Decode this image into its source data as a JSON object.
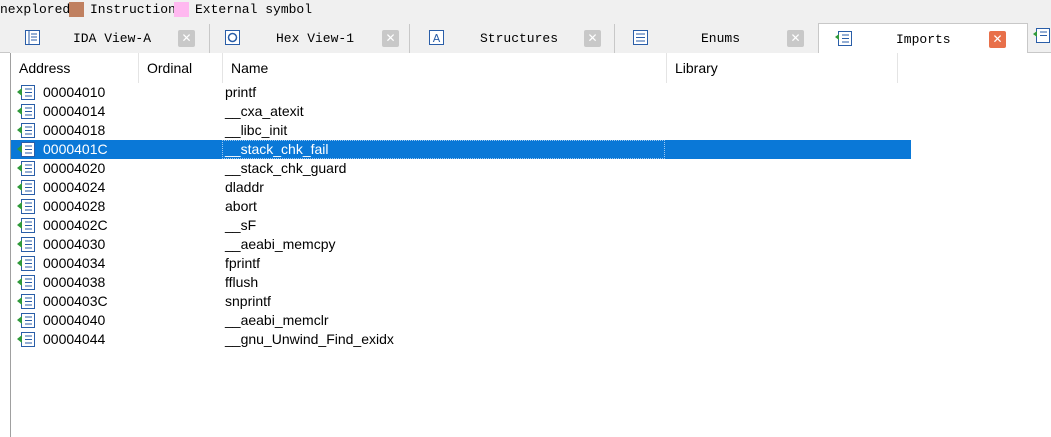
{
  "legend": {
    "items": [
      {
        "label": "nexplored",
        "color": null
      },
      {
        "label": "Instruction",
        "color": "#c08060"
      },
      {
        "label": "External symbol",
        "color": "#ffb8f0"
      }
    ]
  },
  "tabs": [
    {
      "label": "IDA View-A",
      "icon": "ida-view-icon",
      "active": false
    },
    {
      "label": "Hex View-1",
      "icon": "hex-view-icon",
      "active": false
    },
    {
      "label": "Structures",
      "icon": "structures-icon",
      "active": false
    },
    {
      "label": "Enums",
      "icon": "enums-icon",
      "active": false
    },
    {
      "label": "Imports",
      "icon": "imports-icon",
      "active": true
    }
  ],
  "columns": {
    "address": "Address",
    "ordinal": "Ordinal",
    "name": "Name",
    "library": "Library"
  },
  "imports": [
    {
      "address": "00004010",
      "ordinal": "",
      "name": "printf",
      "library": ""
    },
    {
      "address": "00004014",
      "ordinal": "",
      "name": "__cxa_atexit",
      "library": ""
    },
    {
      "address": "00004018",
      "ordinal": "",
      "name": "__libc_init",
      "library": ""
    },
    {
      "address": "0000401C",
      "ordinal": "",
      "name": "__stack_chk_fail",
      "library": "",
      "selected": true
    },
    {
      "address": "00004020",
      "ordinal": "",
      "name": "__stack_chk_guard",
      "library": ""
    },
    {
      "address": "00004024",
      "ordinal": "",
      "name": "dladdr",
      "library": ""
    },
    {
      "address": "00004028",
      "ordinal": "",
      "name": "abort",
      "library": ""
    },
    {
      "address": "0000402C",
      "ordinal": "",
      "name": "__sF",
      "library": ""
    },
    {
      "address": "00004030",
      "ordinal": "",
      "name": "__aeabi_memcpy",
      "library": ""
    },
    {
      "address": "00004034",
      "ordinal": "",
      "name": "fprintf",
      "library": ""
    },
    {
      "address": "00004038",
      "ordinal": "",
      "name": "fflush",
      "library": ""
    },
    {
      "address": "0000403C",
      "ordinal": "",
      "name": "snprintf",
      "library": ""
    },
    {
      "address": "00004040",
      "ordinal": "",
      "name": "__aeabi_memclr",
      "library": ""
    },
    {
      "address": "00004044",
      "ordinal": "",
      "name": "__gnu_Unwind_Find_exidx",
      "library": ""
    }
  ],
  "colors": {
    "selection": "#0a78d7",
    "active_tab_close": "#e8704a",
    "inactive_tab_close": "#c8c8c8"
  }
}
